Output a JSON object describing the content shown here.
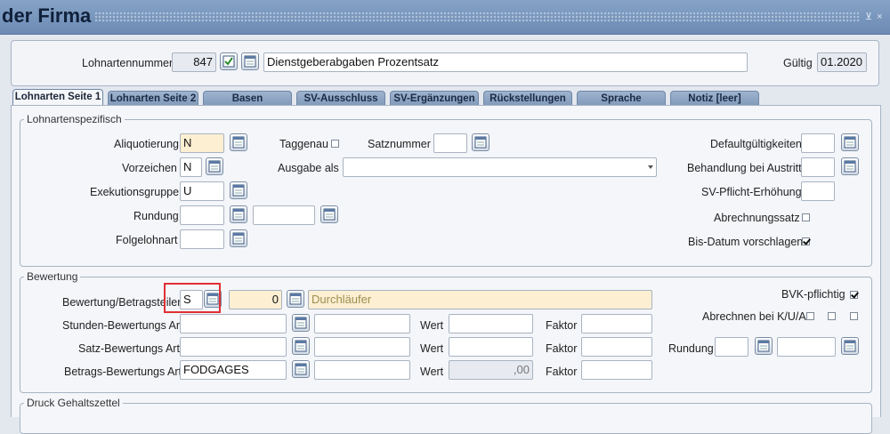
{
  "window": {
    "title": "der Firma",
    "controls": "⊻ ×"
  },
  "header": {
    "lohnartennummer_label": "Lohnartennummer",
    "lohnartennummer_value": "847",
    "bezeichnung_value": "Dienstgeberabgaben Prozentsatz",
    "gueltig_label": "Gültig",
    "gueltig_value": "01.2020"
  },
  "tabs": [
    {
      "label": "Lohnarten Seite 1",
      "active": true
    },
    {
      "label": "Lohnarten Seite 2",
      "active": false
    },
    {
      "label": "Basen",
      "active": false
    },
    {
      "label": "SV-Ausschluss",
      "active": false
    },
    {
      "label": "SV-Ergänzungen",
      "active": false
    },
    {
      "label": "Rückstellungen",
      "active": false
    },
    {
      "label": "Sprache",
      "active": false
    },
    {
      "label": "Notiz [leer]",
      "active": false
    }
  ],
  "lohnartenspezifisch": {
    "legend": "Lohnartenspezifisch",
    "aliquotierung_label": "Aliquotierung",
    "aliquotierung_value": "N",
    "vorzeichen_label": "Vorzeichen",
    "vorzeichen_value": "N",
    "exekutionsgruppe_label": "Exekutionsgruppe",
    "exekutionsgruppe_value": "U",
    "rundung_label": "Rundung",
    "rundung_value": "",
    "rundung_value2": "",
    "folgelohnart_label": "Folgelohnart",
    "folgelohnart_value": "",
    "taggenau_label": "Taggenau",
    "taggenau_checked": false,
    "satznummer_label": "Satznummer",
    "satznummer_value": "",
    "ausgabe_als_label": "Ausgabe als",
    "ausgabe_als_value": "",
    "defaultgueltigkeiten_label": "Defaultgültigkeiten",
    "behandlung_austritt_label": "Behandlung bei Austritt",
    "sv_pflicht_label": "SV-Pflicht-Erhöhung",
    "abrechnungssatz_label": "Abrechnungssatz",
    "abrechnungssatz_checked": false,
    "bis_datum_label": "Bis-Datum vorschlagen",
    "bis_datum_checked": true
  },
  "bewertung": {
    "legend": "Bewertung",
    "betragsteiler_label": "Bewertung/Betragsteiler",
    "betragsteiler_value": "S",
    "betragsteiler_number": "0",
    "betragsteiler_text": "Durchläufer",
    "stunden_label": "Stunden-Bewertungs Art",
    "satz_label": "Satz-Bewertungs Art",
    "betrags_label": "Betrags-Bewertungs Art",
    "betrags_value": "FODGAGES",
    "wert_label": "Wert",
    "faktor_label": "Faktor",
    "betrags_wert_value": ",00",
    "bvk_label": "BVK-pflichtig",
    "bvk_checked": true,
    "abrechnen_label": "Abrechnen bei K/U/A",
    "rundung_label": "Rundung"
  },
  "druck": {
    "legend": "Druck Gehaltszettel"
  },
  "colors": {
    "titlebar": "#7a96bc",
    "highlight": "#e02f35",
    "yellow_field": "#fdefd2"
  },
  "icons": [
    "lookup-icon",
    "check-icon",
    "dropdown-arrow-icon"
  ]
}
